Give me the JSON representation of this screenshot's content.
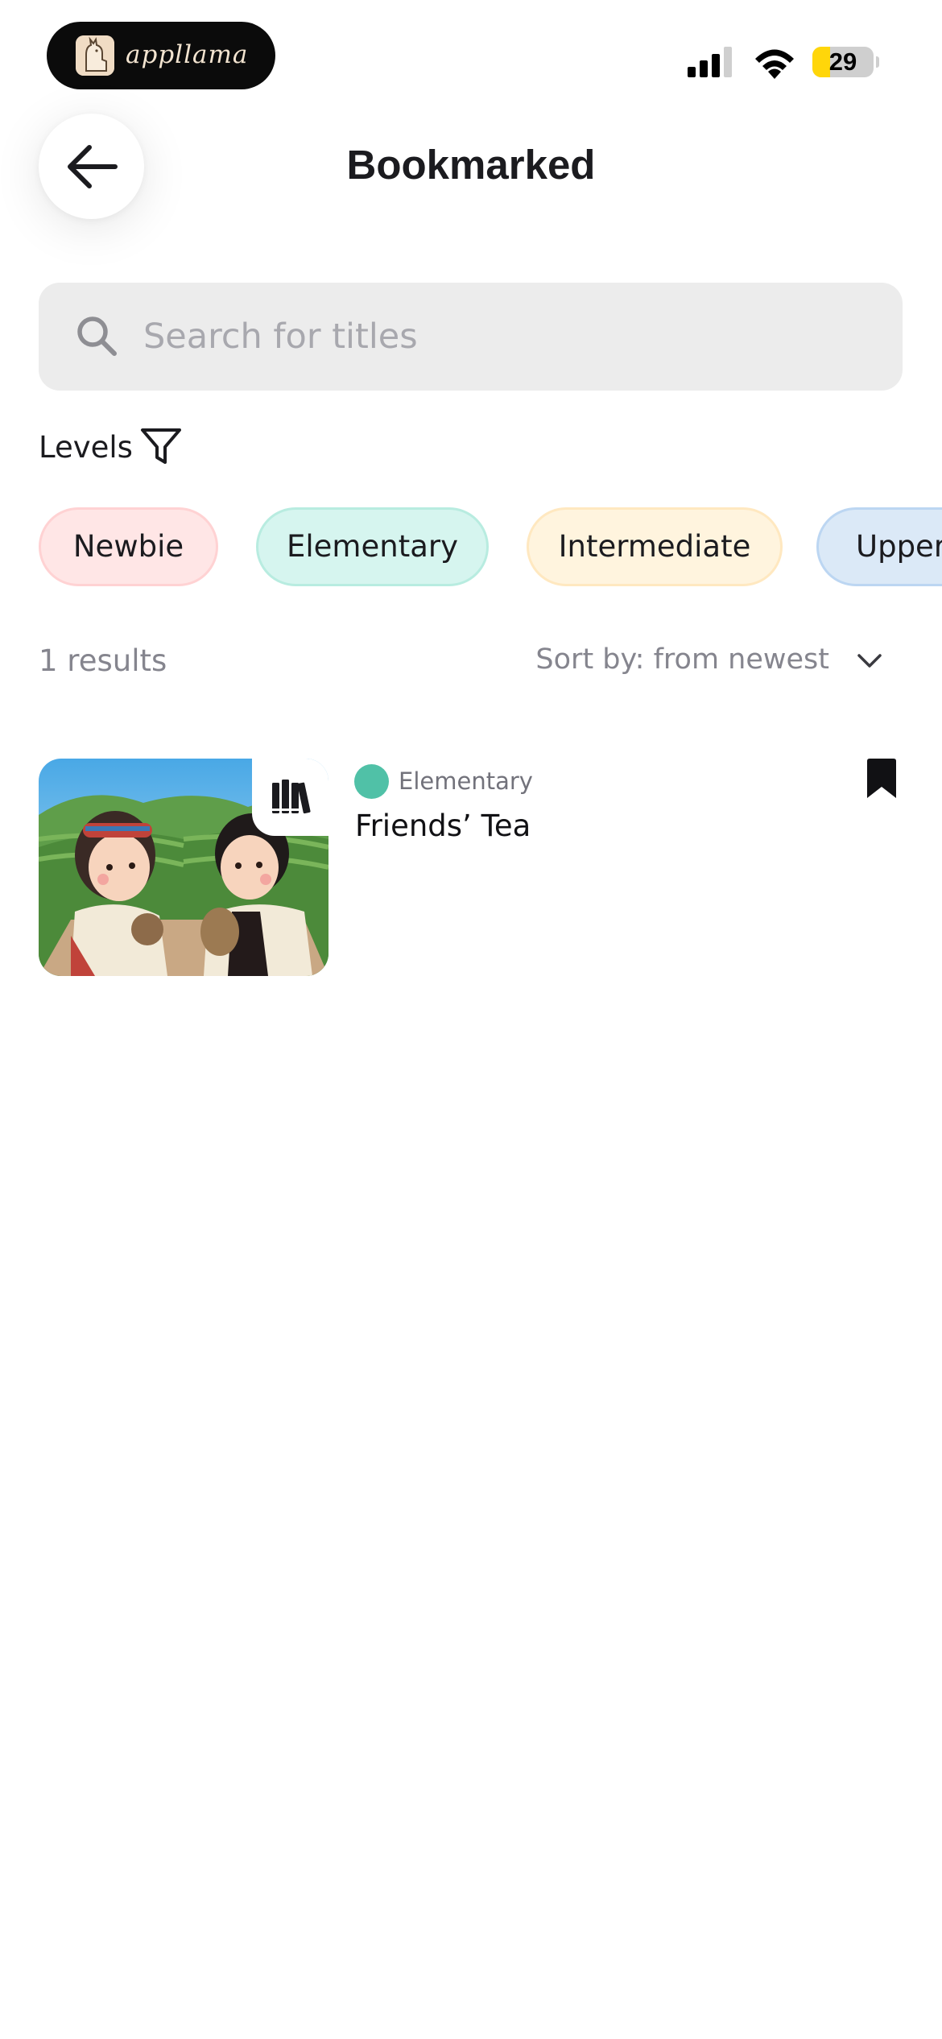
{
  "status_bar": {
    "app_pill_name": "appllama",
    "battery_level": "29",
    "battery_fraction": 0.29
  },
  "header": {
    "title": "Bookmarked",
    "back_icon": "arrow-left-icon"
  },
  "search": {
    "placeholder": "Search for titles",
    "value": "",
    "icon": "search-icon"
  },
  "levels": {
    "label": "Levels",
    "filter_icon": "filter-funnel-icon",
    "chips": [
      {
        "label": "Newbie",
        "color": "#ffe6e6"
      },
      {
        "label": "Elementary",
        "color": "#d6f5ef"
      },
      {
        "label": "Intermediate",
        "color": "#fff4de"
      },
      {
        "label": "Upper",
        "color": "#dbe9f7"
      }
    ]
  },
  "results": {
    "count_label": "1 results",
    "sort_label": "Sort by: from newest"
  },
  "items": [
    {
      "level": "Elementary",
      "level_color": "#50c1a7",
      "title": "Friends’ Tea",
      "badge_icon": "books-icon",
      "bookmarked": true
    }
  ]
}
